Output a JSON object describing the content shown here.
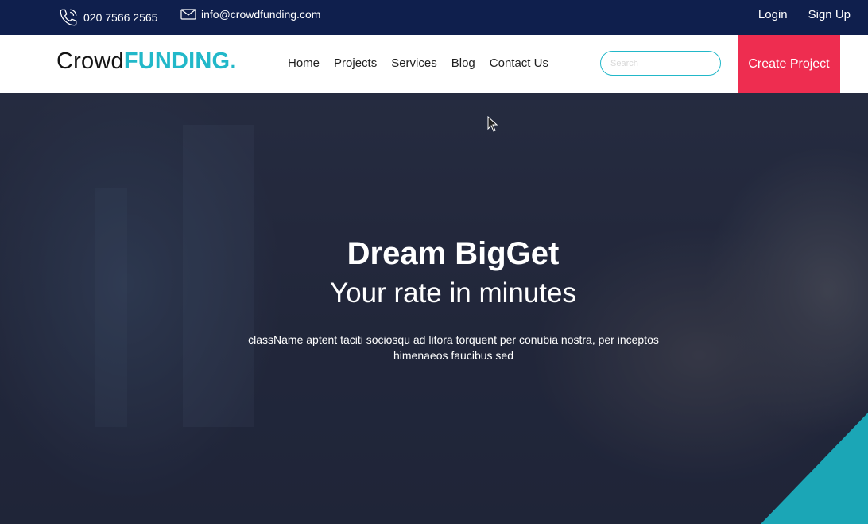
{
  "topbar": {
    "phone": "020 7566 2565",
    "email": "info@crowdfunding.com",
    "login": "Login",
    "signup": "Sign Up",
    "phone_icon": "phone-icon",
    "email_icon": "envelope-icon"
  },
  "header": {
    "logo_part1": "Crowd",
    "logo_part2": "FUNDING.",
    "nav": [
      "Home",
      "Projects",
      "Services",
      "Blog",
      "Contact Us"
    ],
    "search_placeholder": "Search",
    "cta": "Create Project"
  },
  "hero": {
    "title": "Dream BigGet",
    "subtitle": "Your rate in minutes",
    "description": "className aptent taciti sociosqu ad litora torquent per conubia nostra, per inceptos himenaeos faucibus sed"
  },
  "colors": {
    "topbar": "#0f1f4d",
    "accent": "#22b8c9",
    "cta": "#ee2d50"
  }
}
